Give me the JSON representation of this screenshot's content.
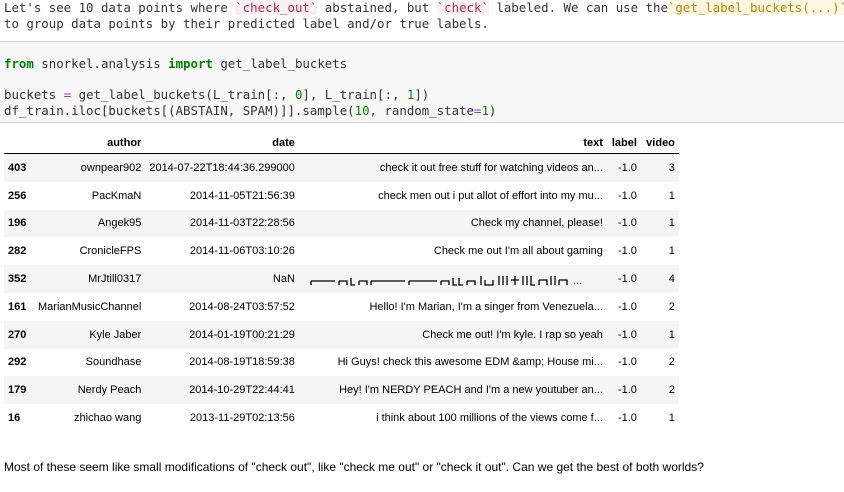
{
  "markdown_top": {
    "line1_a": "Let's see 10 data points where ",
    "line1_tick1": "`check_out`",
    "line1_b": " abstained, but ",
    "line1_tick2": "`check`",
    "line1_c": " labeled. We can use the",
    "line1_tick3": "`get_label_buckets(...)`",
    "line2": "to group data points by their predicted label and/or true labels."
  },
  "code": {
    "l1_kw1": "from",
    "l1_mod": " snorkel.analysis ",
    "l1_kw2": "import",
    "l1_name": " get_label_buckets",
    "l3_a": "buckets ",
    "l3_eq": "=",
    "l3_b": " get_label_buckets(L_train[:, ",
    "l3_n0": "0",
    "l3_c": "], L_train[:, ",
    "l3_n1": "1",
    "l3_d": "])",
    "l4_a": "df_train.iloc[buckets[(ABSTAIN, SPAM)]].sample(",
    "l4_n10": "10",
    "l4_b": ", random_state",
    "l4_eq": "=",
    "l4_n1": "1",
    "l4_c": ")"
  },
  "table": {
    "columns": [
      "",
      "author",
      "date",
      "text",
      "label",
      "video"
    ],
    "rows": [
      {
        "index": "403",
        "author": "ownpear902",
        "date": "2014-07-22T18:44:36.299000",
        "text": "check it out free stuff for watching videos an...",
        "label": "-1.0",
        "video": "3"
      },
      {
        "index": "256",
        "author": "PacKmaN",
        "date": "2014-11-05T21:56:39",
        "text": "check men out i put allot of effort into my mu...",
        "label": "-1.0",
        "video": "1"
      },
      {
        "index": "196",
        "author": "Angek95",
        "date": "2014-11-03T22:28:56",
        "text": "Check my channel, please!",
        "label": "-1.0",
        "video": "1"
      },
      {
        "index": "282",
        "author": "CronicleFPS",
        "date": "2014-11-06T03:10:26",
        "text": "Check me out I'm all about gaming",
        "label": "-1.0",
        "video": "1"
      },
      {
        "index": "352",
        "author": "MrJtill0317",
        "date": "NaN",
        "text": "",
        "label": "-1.0",
        "video": "4"
      },
      {
        "index": "161",
        "author": "MarianMusicChannel",
        "date": "2014-08-24T03:57:52",
        "text": "Hello! I'm Marian, I'm a singer from Venezuela...",
        "label": "-1.0",
        "video": "2"
      },
      {
        "index": "270",
        "author": "Kyle Jaber",
        "date": "2014-01-19T00:21:29",
        "text": "Check me out! I'm kyle. I rap so yeah",
        "label": "-1.0",
        "video": "1"
      },
      {
        "index": "292",
        "author": "Soundhase",
        "date": "2014-08-19T18:59:38",
        "text": "Hi Guys! check this awesome EDM &amp; House mi...",
        "label": "-1.0",
        "video": "2"
      },
      {
        "index": "179",
        "author": "Nerdy Peach",
        "date": "2014-10-29T22:44:41",
        "text": "Hey! I'm NERDY PEACH and I'm a new youtuber an...",
        "label": "-1.0",
        "video": "2"
      },
      {
        "index": "16",
        "author": "zhichao wang",
        "date": "2013-11-29T02:13:56",
        "text": "i think about 100 millions of the views come f...",
        "label": "-1.0",
        "video": "1"
      }
    ]
  },
  "markdown_bottom": "Most of these seem like small modifications of \"check out\", like \"check me out\" or \"check it out\". Can we get the best of both worlds?"
}
